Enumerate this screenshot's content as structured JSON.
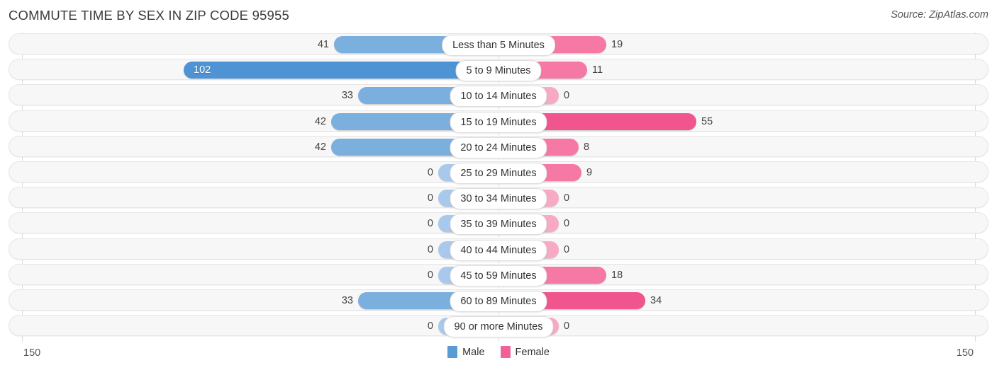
{
  "header": {
    "title": "COMMUTE TIME BY SEX IN ZIP CODE 95955",
    "source": "Source: ZipAtlas.com"
  },
  "legend": {
    "items": [
      {
        "label": "Male",
        "color": "#5B9BD5"
      },
      {
        "label": "Female",
        "color": "#F0619A"
      }
    ]
  },
  "axis": {
    "left_tick": "150",
    "right_tick": "150"
  },
  "colors": {
    "male_strong": "#4E93D4",
    "male_mid": "#7BAFDE",
    "male_light": "#A9C9EC",
    "female_strong": "#F0558E",
    "female_mid": "#F578A5",
    "female_light": "#F8A9C4",
    "row_background": "#F7F7F7",
    "row_border": "#E6E6E6",
    "gridline": "#DDDDDD"
  },
  "chart_data": {
    "type": "bar",
    "orientation": "horizontal-diverging",
    "title": "COMMUTE TIME BY SEX IN ZIP CODE 95955",
    "xlabel": "",
    "ylabel": "",
    "xlim": [
      150,
      150
    ],
    "grid": true,
    "legend_position": "bottom-center",
    "categories": [
      "Less than 5 Minutes",
      "5 to 9 Minutes",
      "10 to 14 Minutes",
      "15 to 19 Minutes",
      "20 to 24 Minutes",
      "25 to 29 Minutes",
      "30 to 34 Minutes",
      "35 to 39 Minutes",
      "40 to 44 Minutes",
      "45 to 59 Minutes",
      "60 to 89 Minutes",
      "90 or more Minutes"
    ],
    "series": [
      {
        "name": "Male",
        "values": [
          41,
          102,
          33,
          42,
          42,
          0,
          0,
          0,
          0,
          0,
          33,
          0
        ]
      },
      {
        "name": "Female",
        "values": [
          19,
          11,
          0,
          55,
          8,
          9,
          0,
          0,
          0,
          18,
          34,
          0
        ]
      }
    ]
  },
  "rows": [
    {
      "label": "Less than 5 Minutes",
      "male": "41",
      "female": "19",
      "male_w": 232,
      "female_w": 152,
      "male_tone": "male_mid",
      "female_tone": "female_mid",
      "male_inside": false
    },
    {
      "label": "5 to 9 Minutes",
      "male": "102",
      "female": "11",
      "male_w": 444,
      "female_w": 125,
      "male_tone": "male_strong",
      "female_tone": "female_mid",
      "male_inside": true
    },
    {
      "label": "10 to 14 Minutes",
      "male": "33",
      "female": "0",
      "male_w": 198,
      "female_w": 85,
      "male_tone": "male_mid",
      "female_tone": "female_light",
      "male_inside": false
    },
    {
      "label": "15 to 19 Minutes",
      "male": "42",
      "female": "55",
      "male_w": 236,
      "female_w": 279,
      "male_tone": "male_mid",
      "female_tone": "female_strong",
      "male_inside": false
    },
    {
      "label": "20 to 24 Minutes",
      "male": "42",
      "female": "8",
      "male_w": 236,
      "female_w": 113,
      "male_tone": "male_mid",
      "female_tone": "female_mid",
      "male_inside": false
    },
    {
      "label": "25 to 29 Minutes",
      "male": "0",
      "female": "9",
      "male_w": 85,
      "female_w": 117,
      "male_tone": "male_light",
      "female_tone": "female_mid",
      "male_inside": false
    },
    {
      "label": "30 to 34 Minutes",
      "male": "0",
      "female": "0",
      "male_w": 85,
      "female_w": 85,
      "male_tone": "male_light",
      "female_tone": "female_light",
      "male_inside": false
    },
    {
      "label": "35 to 39 Minutes",
      "male": "0",
      "female": "0",
      "male_w": 85,
      "female_w": 85,
      "male_tone": "male_light",
      "female_tone": "female_light",
      "male_inside": false
    },
    {
      "label": "40 to 44 Minutes",
      "male": "0",
      "female": "0",
      "male_w": 85,
      "female_w": 85,
      "male_tone": "male_light",
      "female_tone": "female_light",
      "male_inside": false
    },
    {
      "label": "45 to 59 Minutes",
      "male": "0",
      "female": "18",
      "male_w": 85,
      "female_w": 152,
      "male_tone": "male_light",
      "female_tone": "female_mid",
      "male_inside": false
    },
    {
      "label": "60 to 89 Minutes",
      "male": "33",
      "female": "34",
      "male_w": 198,
      "female_w": 207,
      "male_tone": "male_mid",
      "female_tone": "female_strong",
      "male_inside": false
    },
    {
      "label": "90 or more Minutes",
      "male": "0",
      "female": "0",
      "male_w": 85,
      "female_w": 85,
      "male_tone": "male_light",
      "female_tone": "female_light",
      "male_inside": false
    }
  ]
}
